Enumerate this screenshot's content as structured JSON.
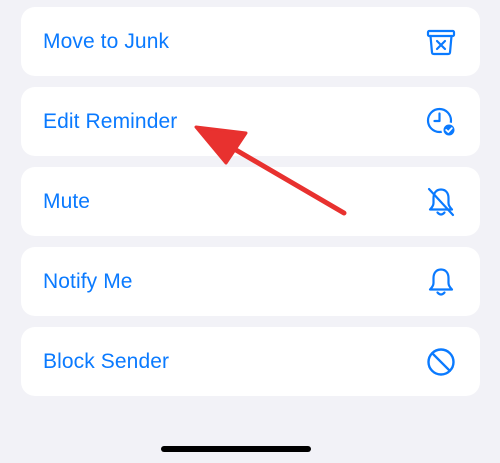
{
  "menu": {
    "items": [
      {
        "label": "Move to Junk",
        "icon": "junk-bin-icon"
      },
      {
        "label": "Edit Reminder",
        "icon": "clock-check-icon"
      },
      {
        "label": "Mute",
        "icon": "bell-slash-icon"
      },
      {
        "label": "Notify Me",
        "icon": "bell-icon"
      },
      {
        "label": "Block Sender",
        "icon": "block-icon"
      }
    ]
  },
  "colors": {
    "accent": "#0a7aff",
    "background": "#f2f2f7",
    "card": "#ffffff",
    "annotation_arrow": "#e8312f"
  }
}
